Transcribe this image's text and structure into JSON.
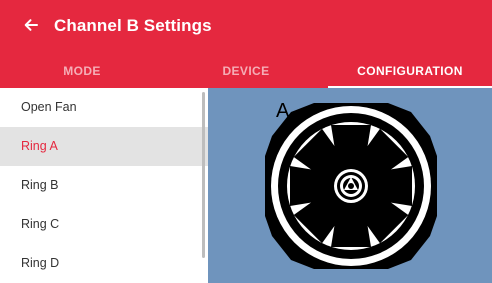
{
  "header": {
    "title": "Channel B Settings",
    "back_icon": "arrow-left-icon"
  },
  "tabs": [
    {
      "label": "MODE",
      "active": false
    },
    {
      "label": "DEVICE",
      "active": false
    },
    {
      "label": "CONFIGURATION",
      "active": true
    }
  ],
  "list": {
    "items": [
      {
        "label": "Open Fan",
        "selected": false
      },
      {
        "label": "Ring A",
        "selected": true
      },
      {
        "label": "Ring B",
        "selected": false
      },
      {
        "label": "Ring C",
        "selected": false
      },
      {
        "label": "Ring D",
        "selected": false
      }
    ]
  },
  "preview": {
    "label": "A"
  },
  "colors": {
    "accent": "#e5283f",
    "panel_background": "#6f94bd",
    "selected_row": "#e3e3e3"
  }
}
